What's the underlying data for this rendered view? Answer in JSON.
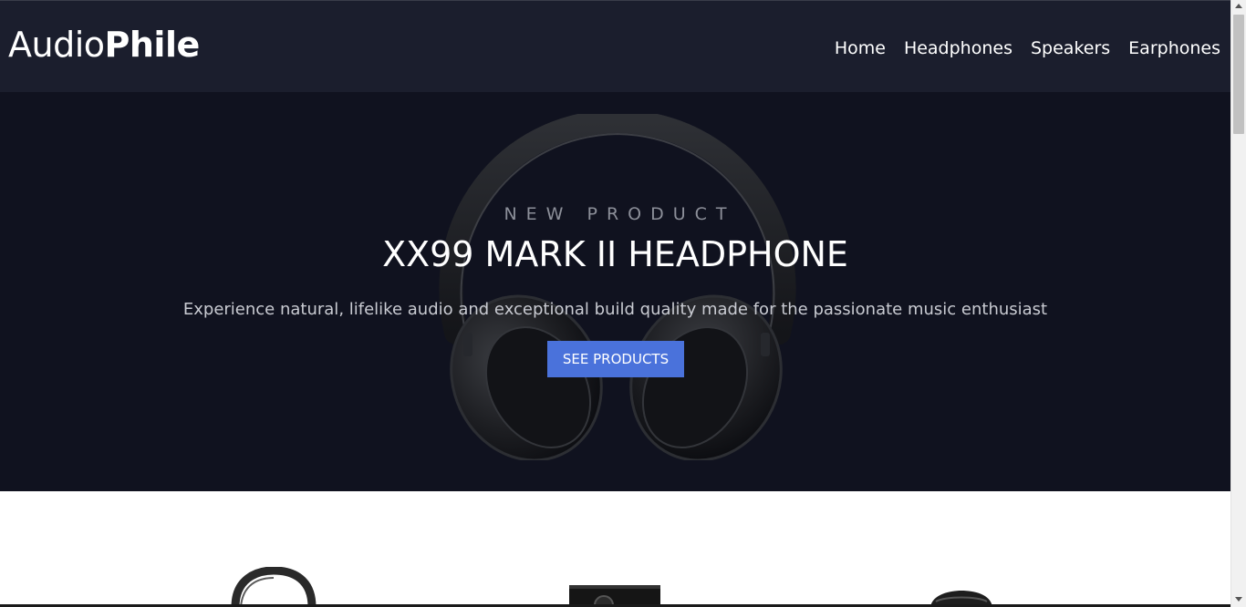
{
  "brand": {
    "light": "Audio",
    "bold": "Phile"
  },
  "nav": {
    "items": [
      {
        "label": "Home"
      },
      {
        "label": "Headphones"
      },
      {
        "label": "Speakers"
      },
      {
        "label": "Earphones"
      }
    ]
  },
  "hero": {
    "overline": "NEW PRODUCT",
    "title": "XX99 MARK II HEADPHONE",
    "description": "Experience natural, lifelike audio and exceptional build quality made for the passionate music enthusiast",
    "cta_label": "SEE PRODUCTS",
    "image_icon": "headphones-image"
  },
  "categories": {
    "icons": [
      "headphones-thumbnail",
      "speaker-thumbnail",
      "earphones-thumbnail"
    ]
  },
  "colors": {
    "header_bg": "#1b1e2d",
    "hero_bg": "#10121f",
    "accent": "#4a72db",
    "text_light": "#ffffff",
    "text_muted": "#8c8f99"
  }
}
